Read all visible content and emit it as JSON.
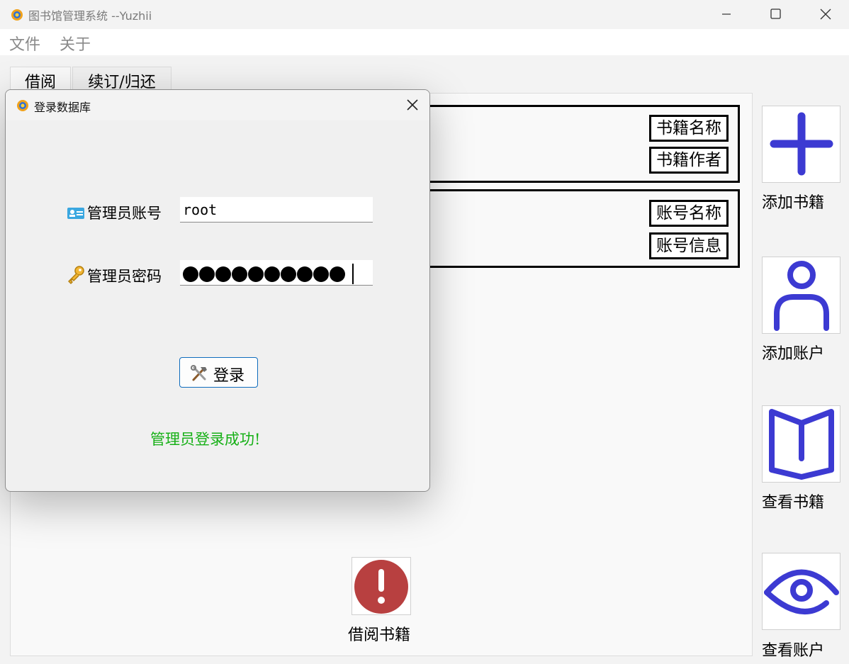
{
  "window": {
    "title": "图书馆管理系统 --Yuzhii",
    "menu": [
      "文件",
      "关于"
    ]
  },
  "tabs": [
    "借阅",
    "续订/归还"
  ],
  "book_group": {
    "name_button": "书籍名称",
    "author_button": "书籍作者"
  },
  "account_group": {
    "name_button": "账号名称",
    "info_button": "账号信息"
  },
  "side_actions": [
    "添加书籍",
    "添加账户",
    "查看书籍",
    "查看账户"
  ],
  "borrow_button_label": "借阅书籍",
  "dialog": {
    "title": "登录数据库",
    "account_label": "管理员账号",
    "account_value": "root",
    "password_label": "管理员密码",
    "password_length": 10,
    "login_label": "登录",
    "status_message": "管理员登录成功!"
  },
  "colors": {
    "icon_accent": "#3c3ad2",
    "warning": "#b84040",
    "success": "#16b016",
    "focus_border": "#0f6cbd"
  },
  "icons": {
    "app": "app-logo-icon",
    "add_book": "plus-icon",
    "add_account": "person-icon",
    "view_books": "open-book-icon",
    "view_accounts": "eye-icon",
    "borrow": "exclamation-icon",
    "account": "id-card-icon",
    "password": "key-icon",
    "login": "tools-icon"
  }
}
